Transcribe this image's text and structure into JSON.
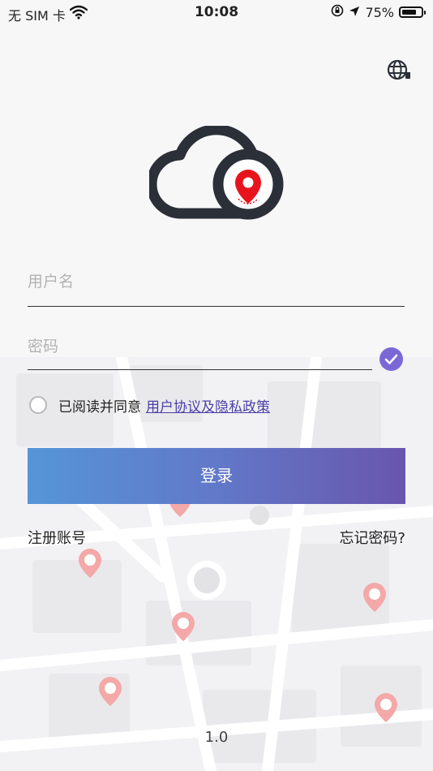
{
  "status_bar": {
    "carrier": "无 SIM 卡",
    "time": "10:08",
    "battery": "75%",
    "battery_level": 0.75,
    "icons": [
      "wifi-icon",
      "rotation-lock-icon",
      "location-arrow-icon",
      "battery-icon"
    ]
  },
  "header": {
    "language_icon": "globe-icon"
  },
  "logo": {
    "icon": "cloud-location-pin-logo",
    "pin_color": "#e8141c",
    "cloud_color": "#2b2f38"
  },
  "form": {
    "username_placeholder": "用户名",
    "username_value": "",
    "password_placeholder": "密码",
    "password_value": "",
    "password_toggle_icon": "check-circle-icon",
    "password_toggle_color": "#7b68d6"
  },
  "agreement": {
    "checked": false,
    "text": "已阅读并同意",
    "link_text": "用户协议及隐私政策"
  },
  "login_button": {
    "label": "登录",
    "gradient": [
      "#5595d8",
      "#6956ad"
    ]
  },
  "links": {
    "register": "注册账号",
    "forgot_password": "忘记密码?"
  },
  "footer": {
    "version": "1.0"
  },
  "background": {
    "type": "map-illustration",
    "marker_color": "#f4a8a8"
  }
}
